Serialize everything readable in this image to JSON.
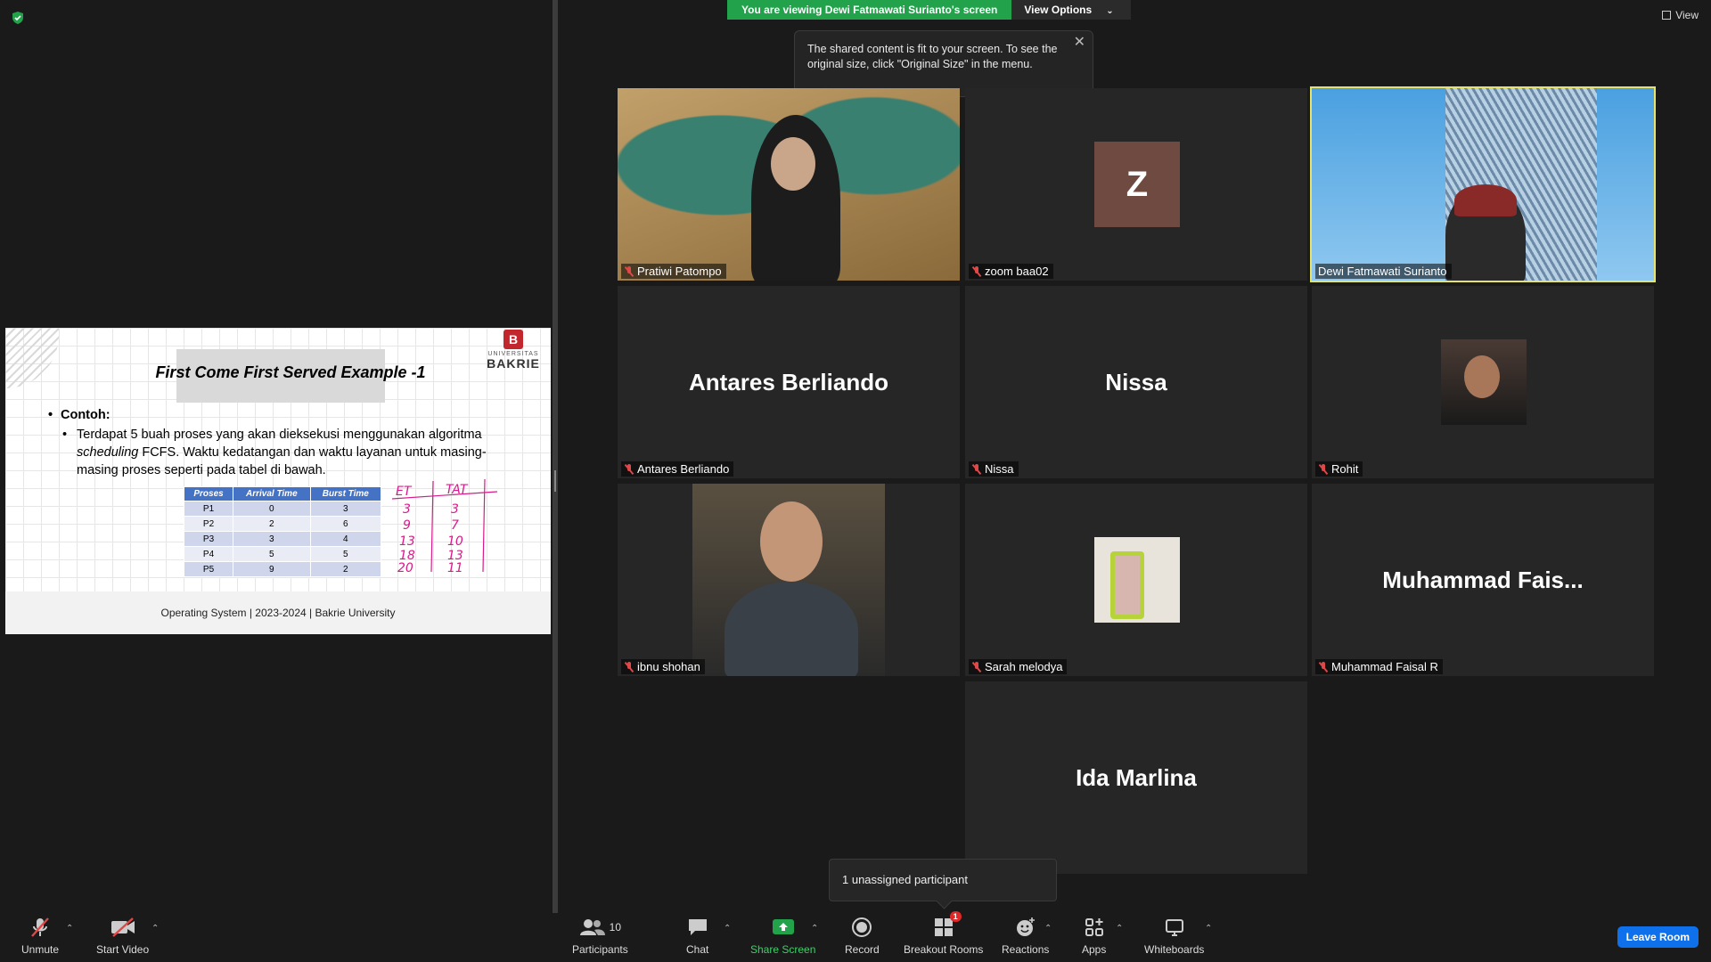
{
  "banner": {
    "viewing": "You are viewing Dewi Fatmawati Surianto's screen",
    "view_options": "View Options"
  },
  "tooltip": {
    "text": "The shared content is fit to your screen. To see the original size, click \"Original Size\" in the menu."
  },
  "view_button": {
    "label": "View"
  },
  "slide": {
    "title": "First Come First Served Example -1",
    "logo_small": "UNIVERSITAS",
    "logo_big": "BAKRIE",
    "logo_letter": "B",
    "bullet_heading": "Contoh:",
    "bullet_text_1": "Terdapat 5 buah proses yang akan dieksekusi menggunakan algoritma ",
    "bullet_text_italic": "scheduling",
    "bullet_text_2": " FCFS. Waktu kedatangan dan waktu layanan untuk masing-masing proses seperti pada tabel di bawah.",
    "table_headers": [
      "Proses",
      "Arrival Time",
      "Burst Time"
    ],
    "table_rows": [
      [
        "P1",
        "0",
        "3"
      ],
      [
        "P2",
        "2",
        "6"
      ],
      [
        "P3",
        "3",
        "4"
      ],
      [
        "P4",
        "5",
        "5"
      ],
      [
        "P5",
        "9",
        "2"
      ]
    ],
    "handwriting_headers": [
      "ET",
      "TAT"
    ],
    "handwriting_et": [
      "3",
      "9",
      "13",
      "18",
      "20"
    ],
    "handwriting_tat": [
      "3",
      "7",
      "10",
      "13",
      "11"
    ],
    "footer": "Operating System | 2023-2024 | Bakrie University"
  },
  "tiles": [
    {
      "name": "Pratiwi Patompo"
    },
    {
      "name": "zoom baa02",
      "avatar_letter": "Z"
    },
    {
      "name": "Dewi Fatmawati Surianto"
    },
    {
      "name": "Antares Berliando",
      "display": "Antares Berliando"
    },
    {
      "name": "Nissa",
      "display": "Nissa"
    },
    {
      "name": "Rohit"
    },
    {
      "name": "ibnu shohan"
    },
    {
      "name": "Sarah melodya"
    },
    {
      "name": "Muhammad Faisal R",
      "display": "Muhammad  Fais..."
    },
    {
      "display": "Ida Marlina"
    }
  ],
  "unassigned": "1 unassigned participant",
  "toolbar": {
    "unmute": "Unmute",
    "start_video": "Start Video",
    "participants": "Participants",
    "participants_count": "10",
    "chat": "Chat",
    "share_screen": "Share Screen",
    "record": "Record",
    "breakout_rooms": "Breakout Rooms",
    "breakout_badge": "1",
    "reactions": "Reactions",
    "apps": "Apps",
    "whiteboards": "Whiteboards",
    "leave": "Leave Room"
  },
  "colors": {
    "share_green": "#22a34b",
    "active_speaker": "#e6e36b",
    "leave_blue": "#0e71eb",
    "muted_red": "#e04848"
  }
}
